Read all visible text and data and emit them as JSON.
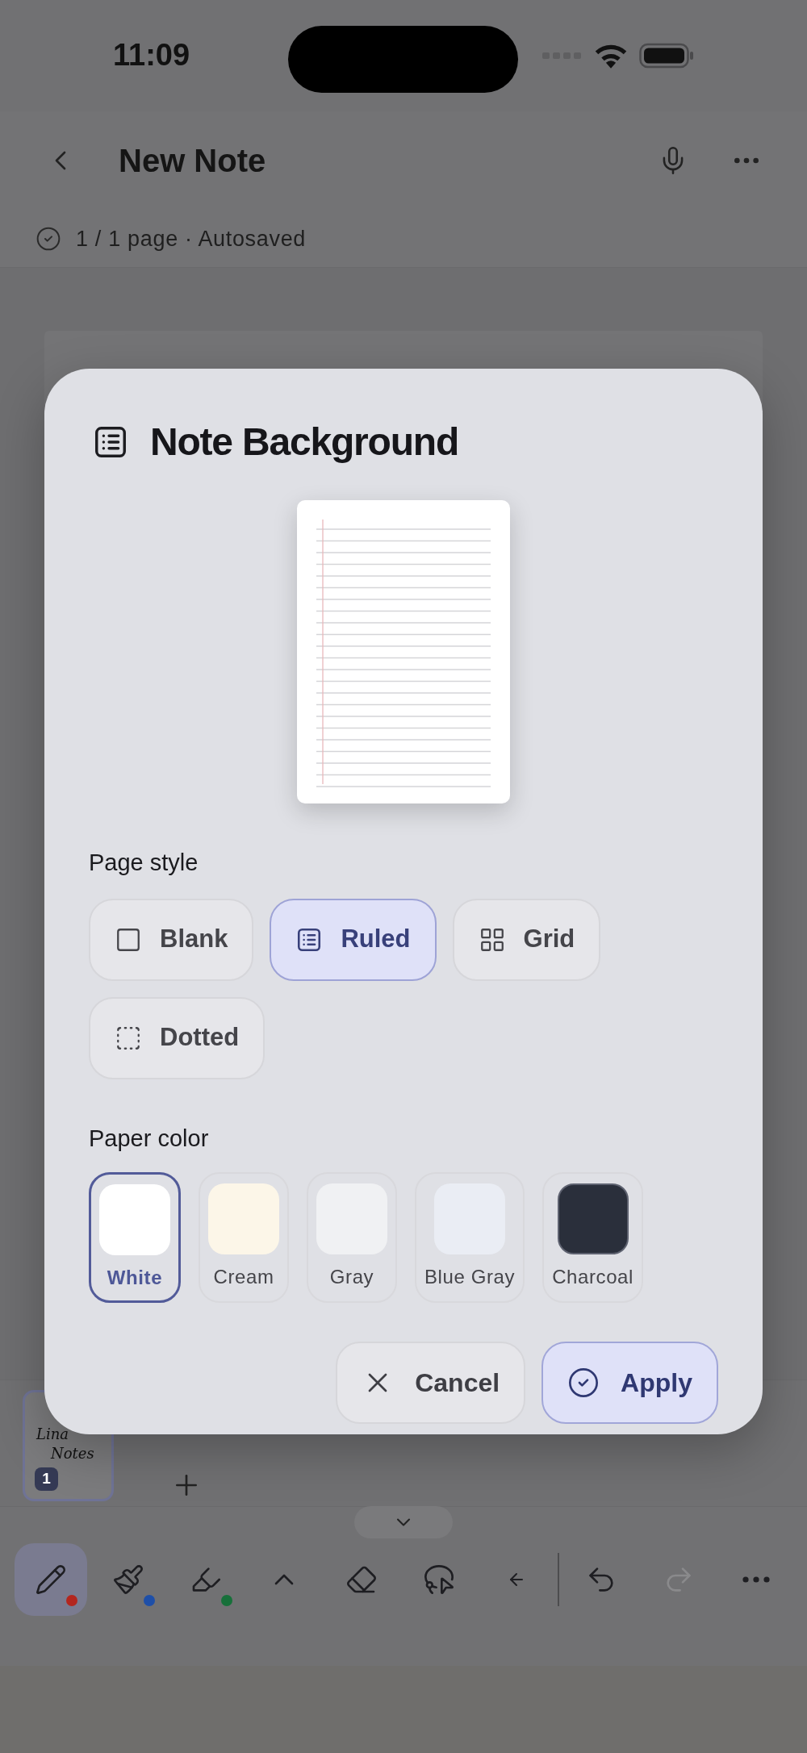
{
  "status_bar": {
    "time": "11:09"
  },
  "header": {
    "title": "New Note",
    "subtitle": "1 / 1 page · Autosaved"
  },
  "dialog": {
    "title": "Note Background",
    "page_style": {
      "label": "Page style",
      "options": [
        {
          "kind": "blank",
          "label": "Blank",
          "selected": false
        },
        {
          "kind": "ruled",
          "label": "Ruled",
          "selected": true
        },
        {
          "kind": "grid",
          "label": "Grid",
          "selected": false
        },
        {
          "kind": "dotted",
          "label": "Dotted",
          "selected": false
        }
      ]
    },
    "paper_color": {
      "label": "Paper color",
      "options": [
        {
          "label": "White",
          "color": "#ffffff",
          "selected": true
        },
        {
          "label": "Cream",
          "color": "#fcf6e8",
          "selected": false
        },
        {
          "label": "Gray",
          "color": "#f0f1f3",
          "selected": false
        },
        {
          "label": "Blue Gray",
          "color": "#eaedf4",
          "selected": false
        },
        {
          "label": "Charcoal",
          "color": "#2a2f3b",
          "selected": false
        }
      ]
    },
    "buttons": [
      {
        "kind": "cancel",
        "label": "Cancel"
      },
      {
        "kind": "apply",
        "label": "Apply"
      }
    ]
  },
  "pages": {
    "thumbnail_lines": [
      "Lina",
      "Notes"
    ],
    "badge": "1"
  },
  "toolbar": [
    {
      "kind": "pen",
      "selected": true,
      "color": "#b3261e"
    },
    {
      "kind": "brush",
      "selected": false,
      "color": "#1e4fa8"
    },
    {
      "kind": "highlighter",
      "selected": false,
      "color": "#17703a"
    },
    {
      "kind": "expand",
      "selected": false
    },
    {
      "kind": "eraser",
      "selected": false
    },
    {
      "kind": "lasso",
      "selected": false
    },
    {
      "kind": "collapse",
      "selected": false
    },
    {
      "kind": "undo",
      "selected": false,
      "disabled": false
    },
    {
      "kind": "redo",
      "selected": false,
      "disabled": true
    },
    {
      "kind": "more",
      "selected": false
    }
  ]
}
